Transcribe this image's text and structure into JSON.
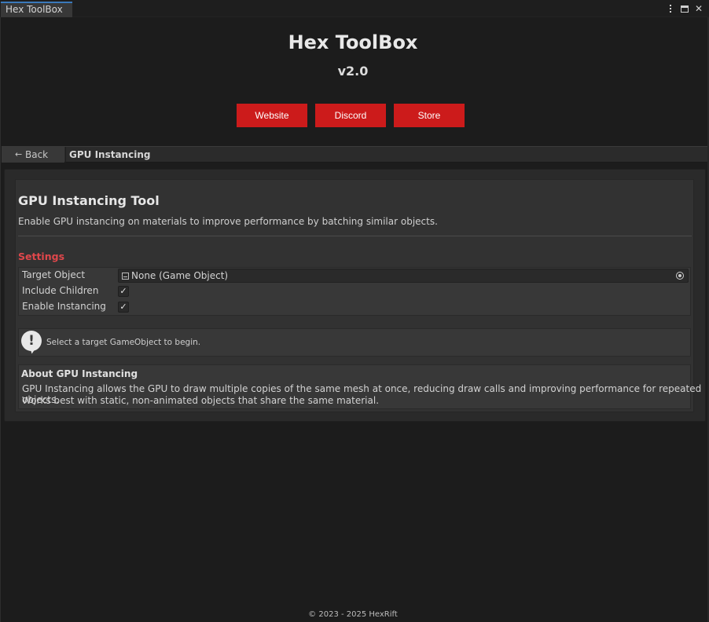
{
  "window": {
    "tab_label": "Hex ToolBox",
    "controls": [
      "kebab-menu-icon",
      "maximize-icon",
      "close-icon"
    ],
    "close_glyph": "✕"
  },
  "header": {
    "title": "Hex ToolBox",
    "version": "v2.0"
  },
  "links": [
    {
      "label": "Website"
    },
    {
      "label": "Discord"
    },
    {
      "label": "Store"
    }
  ],
  "nav": {
    "back_label": "Back",
    "back_icon": "arrow-left-icon",
    "breadcrumb": "GPU Instancing"
  },
  "tool": {
    "title": "GPU Instancing Tool",
    "description": "Enable GPU instancing on materials to improve performance by batching similar objects."
  },
  "settings": {
    "heading": "Settings",
    "target_object_label": "Target Object",
    "target_object_value": "None (Game Object)",
    "include_children_label": "Include Children",
    "include_children_checked": true,
    "enable_instancing_label": "Enable Instancing",
    "enable_instancing_checked": true,
    "check_glyph": "✓"
  },
  "info": {
    "message": "Select a target GameObject to begin.",
    "icon": "info-exclamation-icon"
  },
  "about": {
    "heading": "About GPU Instancing",
    "line1": "GPU Instancing allows the GPU to draw multiple copies of the same mesh at once, reducing draw calls and improving performance for repeated objects.",
    "line2": "Works best with static, non-animated objects that share the same material."
  },
  "footer": {
    "text": "© 2023 - 2025 HexRift"
  },
  "colors": {
    "accent_red": "#cc1b1b",
    "settings_heading": "#e0474b",
    "background": "#1c1c1c"
  }
}
